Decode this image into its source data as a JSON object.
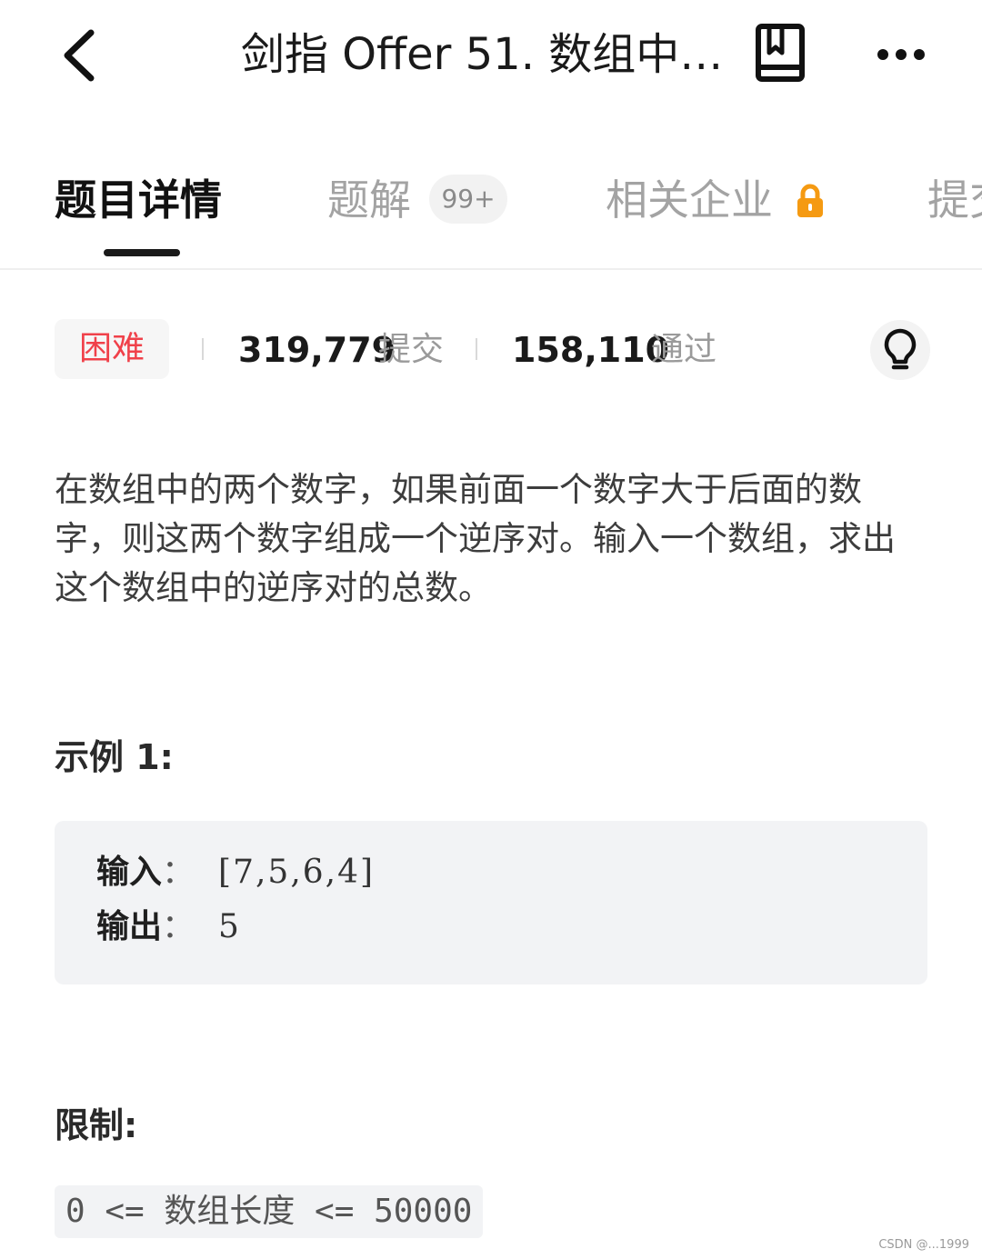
{
  "header": {
    "title": "剑指 Offer 51. 数组中…",
    "back_icon": "back-chevron-icon",
    "book_icon": "bookmark-book-icon",
    "more_icon": "more-dots-icon"
  },
  "tabs": [
    {
      "label": "题目详情",
      "active": true
    },
    {
      "label": "题解",
      "badge": "99+"
    },
    {
      "label": "相关企业",
      "locked": true,
      "lock_color": "#f59a12"
    },
    {
      "label": "提交"
    }
  ],
  "stats": {
    "difficulty": "困难",
    "difficulty_color": "#f0414a",
    "submissions": "319,779",
    "submissions_label": "提交",
    "accepted": "158,110",
    "accepted_label": "通过",
    "hint_icon": "lightbulb-icon"
  },
  "description": "在数组中的两个数字，如果前面一个数字大于后面的数字，则这两个数字组成一个逆序对。输入一个数组，求出这个数组中的逆序对的总数。",
  "example": {
    "title": "示例 1:",
    "input_label": "输入",
    "input_value": "[7,5,6,4]",
    "output_label": "输出",
    "output_value": "5"
  },
  "constraints": {
    "title": "限制:",
    "text": "0 <= 数组长度 <= 50000"
  },
  "watermark": "CSDN @...1999"
}
